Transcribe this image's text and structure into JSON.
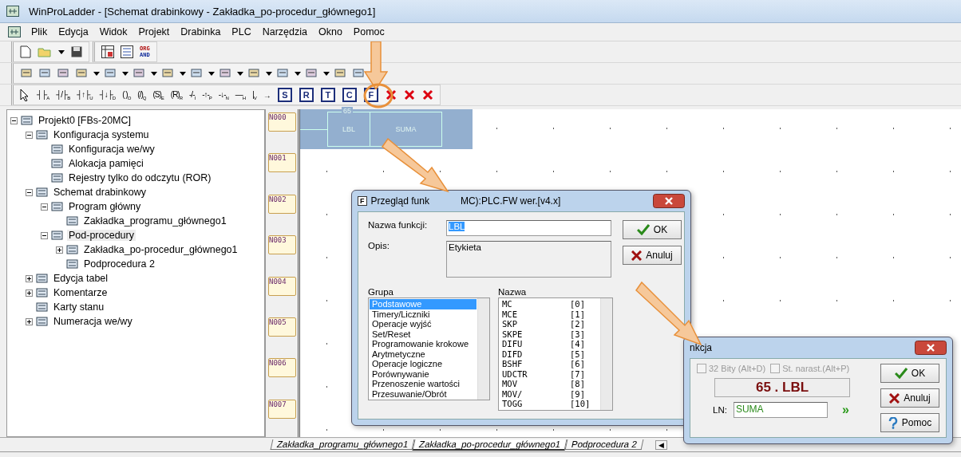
{
  "window": {
    "title": "WinProLadder - [Schemat drabinkowy - Zakładka_po-procedur_głównego1]"
  },
  "menu": [
    "Plik",
    "Edycja",
    "Widok",
    "Projekt",
    "Drabinka",
    "PLC",
    "Narzędzia",
    "Okno",
    "Pomoc"
  ],
  "toolbar_org_and": [
    "ORG",
    "AND"
  ],
  "ladder_toolbar": [
    {
      "kind": "pointer"
    },
    {
      "kind": "sym",
      "glyph": "┤├",
      "letter": "A"
    },
    {
      "kind": "sym",
      "glyph": "┤/├",
      "letter": "B"
    },
    {
      "kind": "sym",
      "glyph": "┤↑├",
      "letter": "U"
    },
    {
      "kind": "sym",
      "glyph": "┤↓├",
      "letter": "D"
    },
    {
      "kind": "sym",
      "glyph": "( )",
      "letter": "O"
    },
    {
      "kind": "sym",
      "glyph": "(/)",
      "letter": "Q"
    },
    {
      "kind": "sym",
      "glyph": "(S)",
      "letter": "E"
    },
    {
      "kind": "sym",
      "glyph": "(R)",
      "letter": "R"
    },
    {
      "kind": "sym",
      "glyph": "-/-",
      "letter": "I"
    },
    {
      "kind": "sym",
      "glyph": "-↑-",
      "letter": "P"
    },
    {
      "kind": "sym",
      "glyph": "-↓-",
      "letter": "N"
    },
    {
      "kind": "sym",
      "glyph": "—",
      "letter": "H"
    },
    {
      "kind": "sym",
      "glyph": "|",
      "letter": "V"
    },
    {
      "kind": "sym",
      "glyph": "→"
    },
    {
      "kind": "box",
      "glyph": "S"
    },
    {
      "kind": "box",
      "glyph": "R"
    },
    {
      "kind": "box",
      "glyph": "T"
    },
    {
      "kind": "box",
      "glyph": "C"
    },
    {
      "kind": "box",
      "glyph": "F"
    },
    {
      "kind": "delete"
    },
    {
      "kind": "delete"
    },
    {
      "kind": "delete"
    }
  ],
  "tree": [
    {
      "label": "Projekt0 [FBs-20MC]",
      "expanded": true,
      "selected": false,
      "children": [
        {
          "label": "Konfiguracja systemu",
          "expanded": true,
          "selected": false,
          "children": [
            {
              "label": "Konfiguracja we/wy",
              "selected": false
            },
            {
              "label": "Alokacja pamięci",
              "selected": false
            },
            {
              "label": "Rejestry tylko do odczytu (ROR)",
              "selected": false
            }
          ]
        },
        {
          "label": "Schemat drabinkowy",
          "expanded": true,
          "selected": false,
          "children": [
            {
              "label": "Program główny",
              "expanded": true,
              "selected": false,
              "children": [
                {
                  "label": "Zakładka_programu_głównego1",
                  "selected": false
                }
              ]
            },
            {
              "label": "Pod-procedury",
              "expanded": true,
              "selected": true,
              "children": [
                {
                  "label": "Zakładka_po-procedur_głównego1",
                  "expanded": false,
                  "selected": false
                },
                {
                  "label": "Podprocedura 2",
                  "selected": false
                }
              ]
            }
          ]
        },
        {
          "label": "Edycja tabel",
          "expanded": false,
          "selected": false
        },
        {
          "label": "Komentarze",
          "expanded": false,
          "selected": false
        },
        {
          "label": "Karty stanu",
          "selected": false
        },
        {
          "label": "Numeracja we/wy",
          "expanded": false,
          "selected": false
        }
      ]
    }
  ],
  "ladder": {
    "rows": [
      "N000",
      "N001",
      "N002",
      "N003",
      "N004",
      "N005",
      "N006",
      "N007"
    ],
    "block": {
      "number": "65",
      "function": "LBL",
      "operand": "SUMA"
    }
  },
  "function_dialog": {
    "icon_letter": "F",
    "title_left": "Przegląd funk",
    "title_right": "MC):PLC.FW wer.[v4.x]",
    "name_label": "Nazwa funkcji:",
    "name_value": "LBL",
    "desc_label": "Opis:",
    "desc_value": "Etykieta",
    "ok": "OK",
    "cancel": "Anuluj",
    "group_label": "Grupa",
    "groups": [
      {
        "label": "Podstawowe",
        "selected": true
      },
      {
        "label": "Timery/Liczniki",
        "selected": false
      },
      {
        "label": "Operacje wyjść",
        "selected": false
      },
      {
        "label": "Set/Reset",
        "selected": false
      },
      {
        "label": "Programowanie krokowe",
        "selected": false
      },
      {
        "label": "Arytmetyczne",
        "selected": false
      },
      {
        "label": "Operacje logiczne",
        "selected": false
      },
      {
        "label": "Porównywanie",
        "selected": false
      },
      {
        "label": "Przenoszenie wartości",
        "selected": false
      },
      {
        "label": "Przesuwanie/Obrót",
        "selected": false
      }
    ],
    "names_label": "Nazwa",
    "names": [
      {
        "name": "MC",
        "index": "[0]"
      },
      {
        "name": "MCE",
        "index": "[1]"
      },
      {
        "name": "SKP",
        "index": "[2]"
      },
      {
        "name": "SKPE",
        "index": "[3]"
      },
      {
        "name": "DIFU",
        "index": "[4]"
      },
      {
        "name": "DIFD",
        "index": "[5]"
      },
      {
        "name": "BSHF",
        "index": "[6]"
      },
      {
        "name": "UDCTR",
        "index": "[7]"
      },
      {
        "name": "MOV",
        "index": "[8]"
      },
      {
        "name": "MOV/",
        "index": "[9]"
      },
      {
        "name": "TOGG",
        "index": "[10]"
      }
    ]
  },
  "operand_dialog": {
    "title": "nkcja",
    "options": [
      {
        "label": "32 Bity (Alt+D)",
        "checked": false,
        "disabled": true
      },
      {
        "label": "St. narast.(Alt+P)",
        "checked": false,
        "disabled": true
      }
    ],
    "display": "65 . LBL",
    "ln_label": "LN:",
    "ln_value": "SUMA",
    "next": "»",
    "ok": "OK",
    "cancel": "Anuluj",
    "help": "Pomoc"
  },
  "tabs": [
    {
      "label": "Zakładka_programu_głównego1",
      "selected": false
    },
    {
      "label": "Zakładka_po-procedur_głównego1",
      "selected": true
    },
    {
      "label": "Podprocedura 2",
      "selected": false
    }
  ],
  "tab_scroll": "◀"
}
